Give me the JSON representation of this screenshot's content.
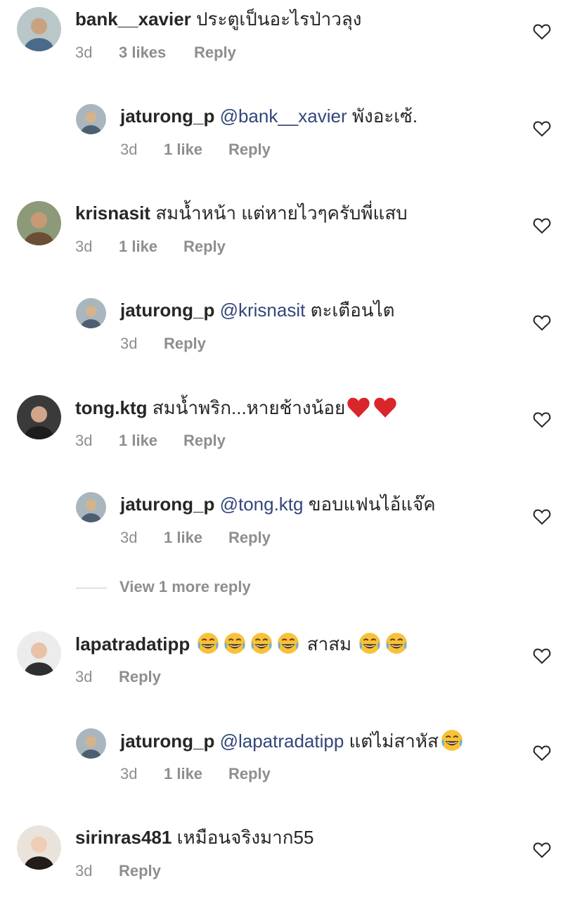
{
  "comments": [
    {
      "type": "top",
      "username": "bank__xavier",
      "mention": "",
      "text": "ประตูเป็นอะไรป่าวลุง",
      "time": "3d",
      "likes": "3 likes",
      "reply": "Reply",
      "avatar": "avatar-bank-xavier"
    },
    {
      "type": "reply",
      "username": "jaturong_p",
      "mention": "@bank__xavier",
      "text": "พังอะเซ้.",
      "time": "3d",
      "likes": "1 like",
      "reply": "Reply",
      "avatar": "avatar-jaturong-p"
    },
    {
      "type": "top",
      "username": "krisnasit",
      "mention": "",
      "text": "สมน้ำหน้า แต่หายไวๆครับพี่แสบ",
      "time": "3d",
      "likes": "1 like",
      "reply": "Reply",
      "avatar": "avatar-krisnasit"
    },
    {
      "type": "reply",
      "username": "jaturong_p",
      "mention": "@krisnasit",
      "text": "ตะเตือนไต",
      "time": "3d",
      "likes": "",
      "reply": "Reply",
      "avatar": "avatar-jaturong-p"
    },
    {
      "type": "top",
      "username": "tong.ktg",
      "mention": "",
      "text": "สมน้ำพริก...หายช้างน้อย",
      "emoji": [
        "red-heart",
        "red-heart"
      ],
      "time": "3d",
      "likes": "1 like",
      "reply": "Reply",
      "avatar": "avatar-tong-ktg"
    },
    {
      "type": "reply",
      "username": "jaturong_p",
      "mention": "@tong.ktg",
      "text": "ขอบแฟนไอ้แจ๊ค",
      "time": "3d",
      "likes": "1 like",
      "reply": "Reply",
      "avatar": "avatar-jaturong-p"
    },
    {
      "type": "top",
      "username": "lapatradatipp",
      "mention": "",
      "text": "สาสม",
      "emoji_before": [
        "tears-of-joy",
        "tears-of-joy",
        "tears-of-joy",
        "tears-of-joy"
      ],
      "emoji": [
        "tears-of-joy",
        "tears-of-joy"
      ],
      "time": "3d",
      "likes": "",
      "reply": "Reply",
      "avatar": "avatar-lapatradatipp"
    },
    {
      "type": "reply",
      "username": "jaturong_p",
      "mention": "@lapatradatipp",
      "text": "แต่ไม่สาหัส",
      "emoji": [
        "tears-of-joy"
      ],
      "time": "3d",
      "likes": "1 like",
      "reply": "Reply",
      "avatar": "avatar-jaturong-p"
    },
    {
      "type": "top",
      "username": "sirinras481",
      "mention": "",
      "text": "เหมือนจริงมาก55",
      "time": "3d",
      "likes": "",
      "reply": "Reply",
      "avatar": "avatar-sirinras481"
    }
  ],
  "view_more": "View 1 more reply",
  "colors": {
    "username": "#262626",
    "mention": "#32467a",
    "meta": "#8e8e8e",
    "heart_outline": "#262626",
    "red_heart": "#d9262b",
    "emoji_yellow": "#f7c23a"
  }
}
